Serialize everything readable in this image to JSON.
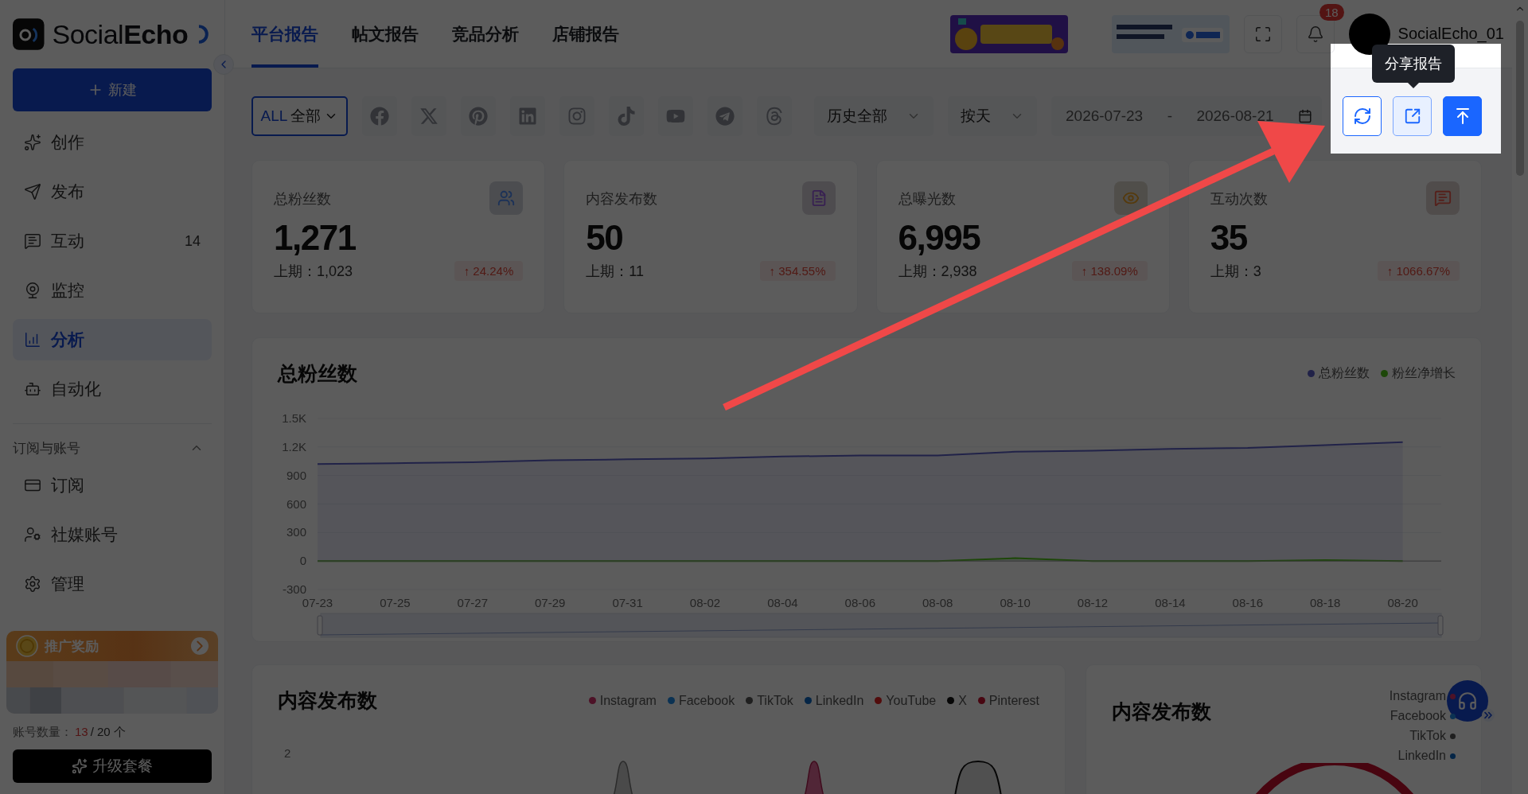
{
  "sidebar": {
    "logo_text": "Social**Echo**",
    "new_button": "新建",
    "nav_items": [
      {
        "label": "创作",
        "selected": false
      },
      {
        "label": "发布",
        "selected": false
      },
      {
        "label": "互动",
        "selected": false,
        "badge": "14"
      },
      {
        "label": "监控",
        "selected": false
      },
      {
        "label": "分析",
        "selected": true
      },
      {
        "label": "自动化",
        "selected": false
      }
    ],
    "section": {
      "title": "订阅与账号",
      "expanded": true,
      "items": [
        {
          "label": "订阅",
          "selected": false
        },
        {
          "label": "社媒账号",
          "selected": false
        },
        {
          "label": "管理",
          "selected": false
        }
      ]
    },
    "promo": {
      "title": "推广奖励"
    },
    "account_usage": {
      "label": "账号数量：",
      "used": "13",
      "total": "/ 20 个"
    },
    "upgrade_button": "升级套餐"
  },
  "header": {
    "tabs": [
      {
        "label": "平台报告",
        "selected": true
      },
      {
        "label": "帖文报告",
        "selected": false
      },
      {
        "label": "竞品分析",
        "selected": false
      },
      {
        "label": "店铺报告",
        "selected": false
      }
    ],
    "notification_count": "18",
    "username": "SocialEcho_01"
  },
  "filters": {
    "account_select": {
      "prefix": "ALL",
      "label": "全部"
    },
    "range_select": "历史全部",
    "granularity_select": "按天",
    "date_start": "2026-07-23",
    "date_separator": "-",
    "date_end": "2026-08-21"
  },
  "guide": {
    "tooltip": "分享报告"
  },
  "stats": [
    {
      "title": "总粉丝数",
      "value": "1,271",
      "previous": "上期：1,023",
      "change": "↑ 24.24%",
      "color": "#1c3258"
    },
    {
      "title": "内容发布数",
      "value": "50",
      "previous": "上期：11",
      "change": "↑ 354.55%",
      "color": "#382152"
    },
    {
      "title": "总曝光数",
      "value": "6,995",
      "previous": "上期：2,938",
      "change": "↑ 138.09%",
      "color": "#563a0c"
    },
    {
      "title": "互动次数",
      "value": "35",
      "previous": "上期：3",
      "change": "↑ 1066.67%",
      "color": "#55201b"
    }
  ],
  "fans_chart": {
    "title": "总粉丝数",
    "chart_data": {
      "type": "area",
      "categories": [
        "07-23",
        "07-25",
        "07-27",
        "07-29",
        "07-31",
        "08-02",
        "08-04",
        "08-06",
        "08-08",
        "08-10",
        "08-12",
        "08-14",
        "08-16",
        "08-18",
        "08-20"
      ],
      "series": [
        {
          "name": "总粉丝数",
          "color": "#5b5fc7",
          "values": [
            1020,
            1030,
            1040,
            1060,
            1070,
            1080,
            1100,
            1110,
            1110,
            1150,
            1160,
            1180,
            1190,
            1220,
            1250
          ]
        },
        {
          "name": "粉丝净增长",
          "color": "#52c41a",
          "values": [
            0,
            0,
            0,
            0,
            0,
            0,
            0,
            0,
            0,
            30,
            0,
            0,
            0,
            10,
            0
          ]
        }
      ],
      "grid": true,
      "ylim": [
        -300,
        1500
      ],
      "yticks": [
        -300,
        0,
        300,
        600,
        900,
        {
          "value": 1200,
          "label": "1.2K"
        },
        {
          "value": 1500,
          "label": "1.5K"
        }
      ]
    }
  },
  "posts_chart": {
    "title": "内容发布数",
    "axis_label": "2",
    "legend": [
      {
        "name": "Instagram",
        "color": "#4d1227"
      },
      {
        "name": "Facebook",
        "color": "#0b3253"
      },
      {
        "name": "TikTok",
        "color": "#1f1f1f"
      },
      {
        "name": "LinkedIn",
        "color": "#042546"
      },
      {
        "name": "YouTube",
        "color": "#520c0c"
      },
      {
        "name": "X",
        "color": "#060606"
      },
      {
        "name": "Pinterest",
        "color": "#480611"
      }
    ]
  },
  "posts_share_chart": {
    "title": "内容发布数",
    "legend": [
      {
        "name": "Instagram",
        "color": "#4d1227"
      },
      {
        "name": "Facebook",
        "color": "#0b3253"
      },
      {
        "name": "TikTok",
        "color": "#1f1f1f"
      },
      {
        "name": "LinkedIn",
        "color": "#042546"
      }
    ]
  }
}
